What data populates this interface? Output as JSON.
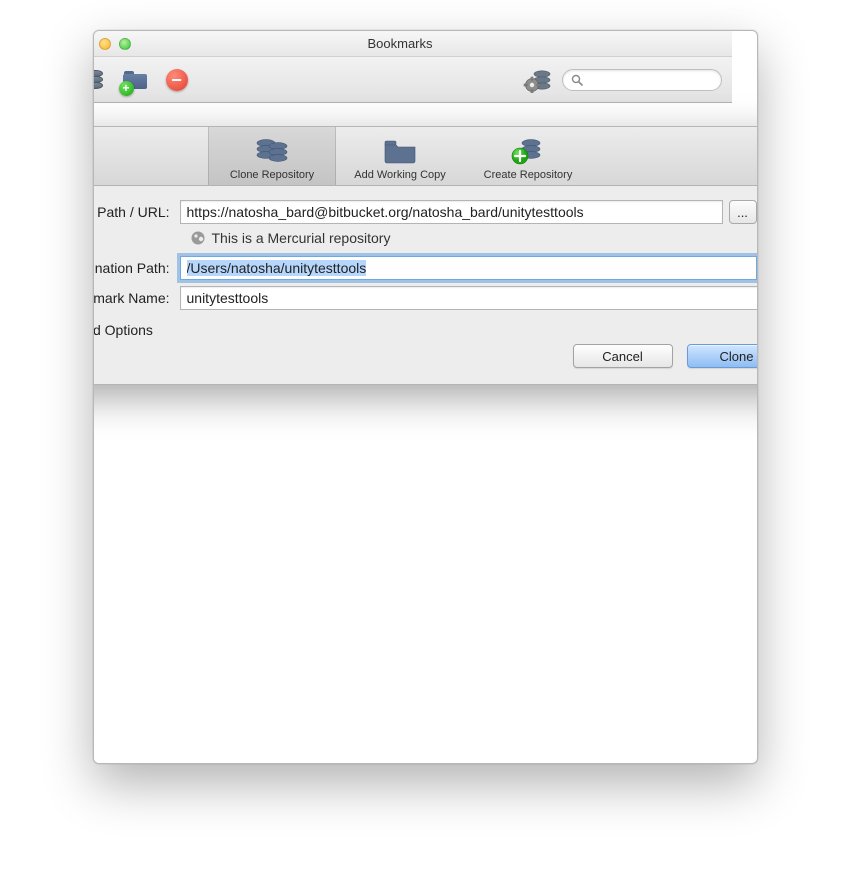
{
  "window": {
    "title": "Bookmarks"
  },
  "toolbar": {
    "search_placeholder": ""
  },
  "segmented": {
    "clone": "Clone Repository",
    "add": "Add Working Copy",
    "create": "Create Repository"
  },
  "form": {
    "source_label": "Source Path / URL:",
    "source_value": "https://natosha_bard@bitbucket.org/natosha_bard/unitytesttools",
    "repo_type_text": "This is a Mercurial repository",
    "dest_label": "Destination Path:",
    "dest_value": "/Users/natosha/unitytesttools",
    "bookmark_label": "Bookmark Name:",
    "bookmark_value": "unitytesttools",
    "browse_label": "...",
    "advanced_label": "Advanced Options"
  },
  "buttons": {
    "cancel": "Cancel",
    "clone": "Clone"
  }
}
